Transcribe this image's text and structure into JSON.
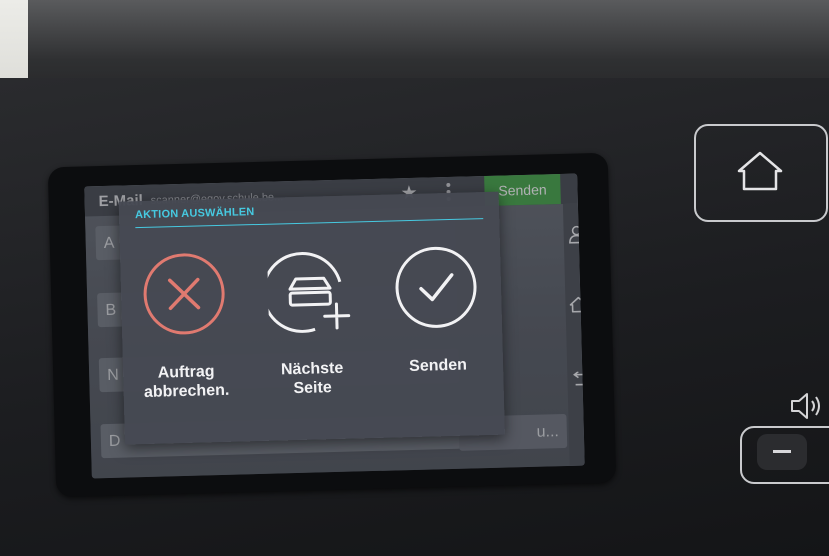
{
  "app": {
    "title": "E-Mail",
    "recipient": "scanner@egov.schule.be...",
    "send_label": "Senden"
  },
  "background_form": {
    "row1_prefix": "A",
    "row2_prefix": "B",
    "row3_prefix": "N",
    "row4_prefix": "D",
    "row4_trailing": "u..."
  },
  "modal": {
    "title": "AKTION AUSWÄHLEN",
    "actions": [
      {
        "line1": "Auftrag",
        "line2": "abbrechen.",
        "icon": "cancel-x-icon",
        "color": "#e07a70"
      },
      {
        "line1": "Nächste",
        "line2": "Seite",
        "icon": "scan-next-page-icon",
        "color": "#f2f2f4"
      },
      {
        "line1": "Senden",
        "line2": "",
        "icon": "check-icon",
        "color": "#f2f2f4"
      }
    ]
  },
  "side_rail": {
    "icons": [
      "person-icon",
      "home-icon",
      "back-icon"
    ]
  },
  "hardware": {
    "buttons": [
      "home-icon",
      "volume-icon",
      "volume-minus-icon"
    ]
  },
  "colors": {
    "accent_cyan": "#46c9e0",
    "send_green": "#49a84c",
    "cancel_red": "#e07a70"
  }
}
